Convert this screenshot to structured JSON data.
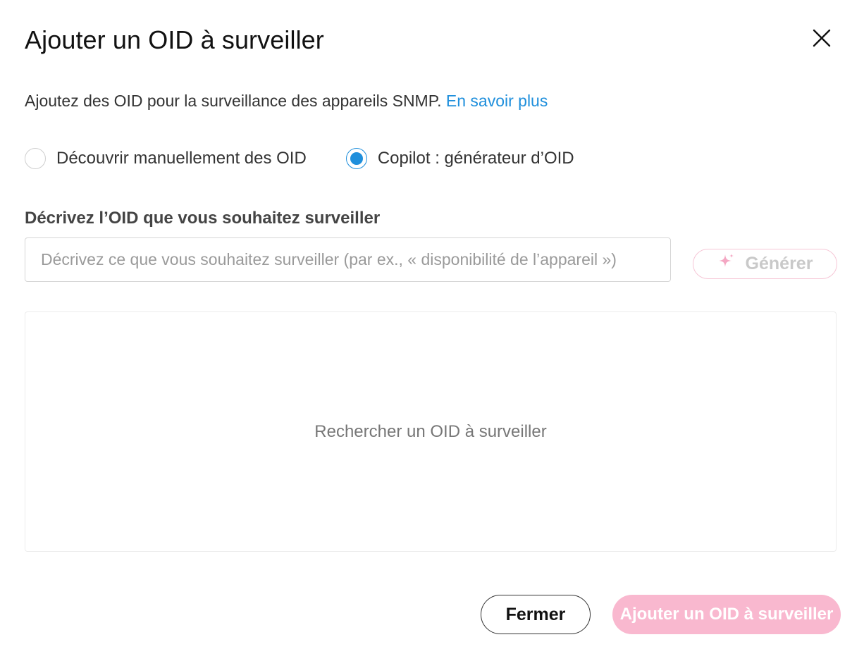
{
  "dialog": {
    "title": "Ajouter un OID à surveiller",
    "close_icon": "close-icon"
  },
  "intro": {
    "text": "Ajoutez des OID pour la surveillance des appareils SNMP.",
    "link": "En savoir plus"
  },
  "mode": {
    "options": [
      {
        "label": "Découvrir manuellement des OID",
        "checked": false
      },
      {
        "label": "Copilot : générateur d’OID",
        "checked": true
      }
    ]
  },
  "describe": {
    "label": "Décrivez l’OID que vous souhaitez surveiller",
    "value": "",
    "placeholder": "Décrivez ce que vous souhaitez surveiller (par ex., « disponibilité de l’appareil »)"
  },
  "generate": {
    "label": "Générer",
    "icon": "sparkle-icon"
  },
  "results": {
    "empty_text": "Rechercher un OID à surveiller"
  },
  "footer": {
    "close_label": "Fermer",
    "add_label": "Ajouter un OID à surveiller"
  },
  "colors": {
    "accent": "#1f8fdc",
    "primary_disabled": "#f9b8cf",
    "sparkle": "#f4a7c3"
  }
}
